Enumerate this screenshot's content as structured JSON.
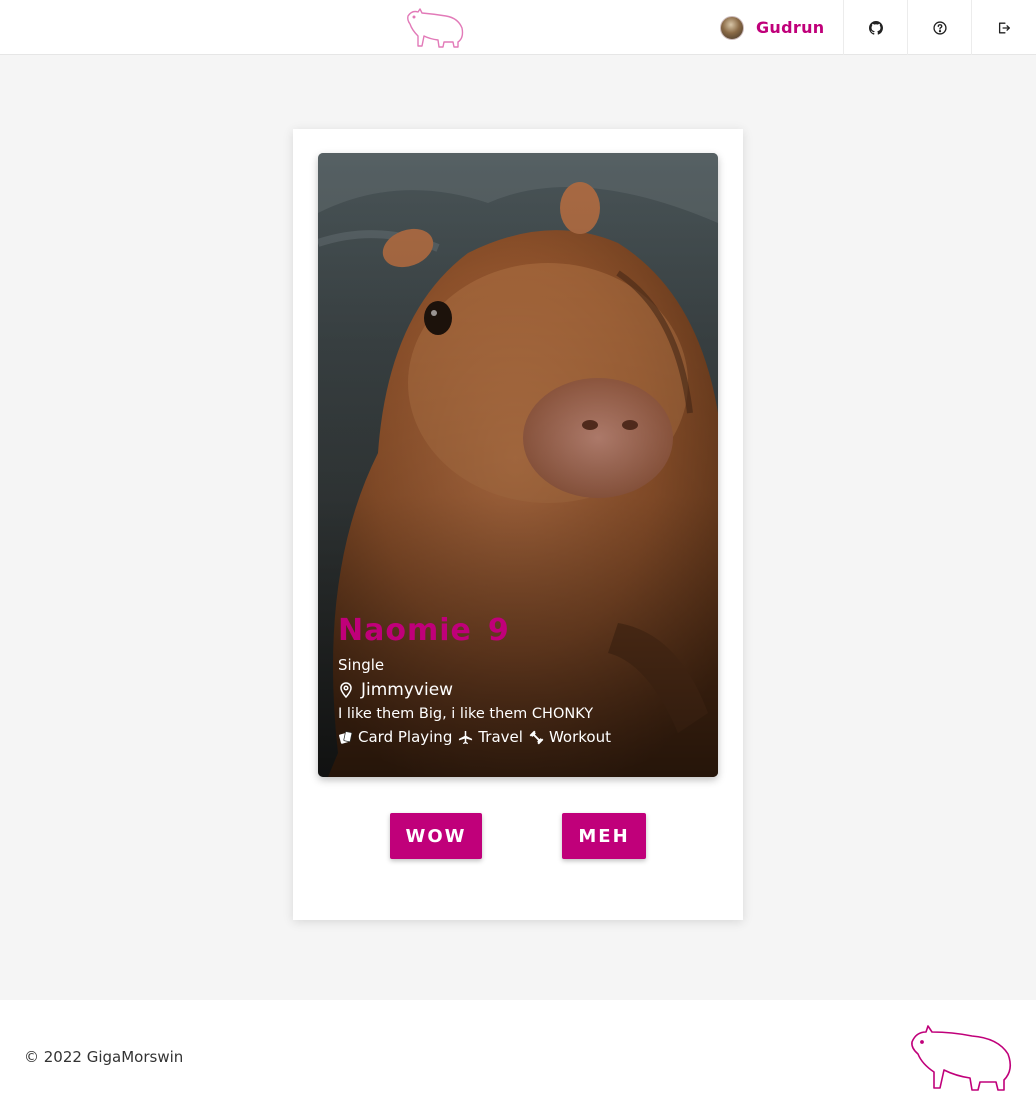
{
  "header": {
    "logo_icon": "capybara-logo-icon",
    "user": {
      "name": "Gudrun",
      "avatar_icon": "user-avatar"
    },
    "buttons": [
      {
        "icon": "github-icon"
      },
      {
        "icon": "help-circle-icon"
      },
      {
        "icon": "logout-icon"
      }
    ]
  },
  "profile": {
    "name": "Naomie",
    "age": "9",
    "status": "Single",
    "location": "Jimmyview",
    "bio": "I like them Big, i like them CHONKY",
    "interests": [
      {
        "label": "Card Playing",
        "icon": "cards-icon"
      },
      {
        "label": "Travel",
        "icon": "airplane-icon"
      },
      {
        "label": "Workout",
        "icon": "dumbbell-icon"
      }
    ]
  },
  "actions": {
    "wow_label": "WOW",
    "meh_label": "MEH"
  },
  "footer": {
    "copyright": "© 2022 GigaMorswin",
    "logo_icon": "capybara-logo-icon"
  },
  "colors": {
    "accent": "#c0007a",
    "background": "#f5f5f5"
  }
}
